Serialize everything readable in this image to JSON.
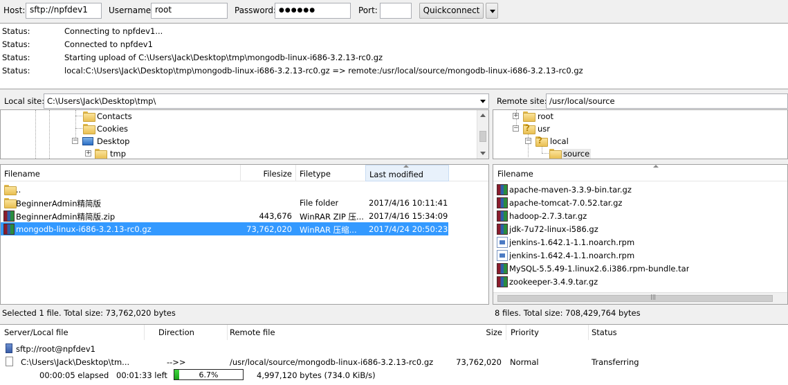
{
  "quickconnect": {
    "host_label": "Host:",
    "host_value": "sftp://npfdev1",
    "username_label": "Username:",
    "username_value": "root",
    "password_label": "Password:",
    "password_value": "●●●●●●",
    "port_label": "Port:",
    "port_value": "",
    "button_label": "Quickconnect"
  },
  "log": [
    {
      "key": "Status:",
      "value": "Connecting to npfdev1..."
    },
    {
      "key": "Status:",
      "value": "Connected to npfdev1"
    },
    {
      "key": "Status:",
      "value": "Starting upload of C:\\Users\\Jack\\Desktop\\tmp\\mongodb-linux-i686-3.2.13-rc0.gz"
    },
    {
      "key": "Status:",
      "value": "local:C:\\Users\\Jack\\Desktop\\tmp\\mongodb-linux-i686-3.2.13-rc0.gz => remote:/usr/local/source/mongodb-linux-i686-3.2.13-rc0.gz"
    }
  ],
  "local": {
    "site_label": "Local site:",
    "site_path": "C:\\Users\\Jack\\Desktop\\tmp\\",
    "tree": [
      "Contacts",
      "Cookies",
      "Desktop",
      "tmp"
    ],
    "columns": [
      "Filename",
      "Filesize",
      "Filetype",
      "Last modified"
    ],
    "files": [
      {
        "name": "..",
        "size": "",
        "type": "",
        "modified": "",
        "icon": "folder-icon"
      },
      {
        "name": "BeginnerAdmin精简版",
        "size": "",
        "type": "File folder",
        "modified": "2017/4/16 10:11:41",
        "icon": "folder-icon"
      },
      {
        "name": "BeginnerAdmin精简版.zip",
        "size": "443,676",
        "type": "WinRAR ZIP 压...",
        "modified": "2017/4/16 15:34:09",
        "icon": "winrar-icon"
      },
      {
        "name": "mongodb-linux-i686-3.2.13-rc0.gz",
        "size": "73,762,020",
        "type": "WinRAR 压缩...",
        "modified": "2017/4/24 20:50:23",
        "icon": "winrar-icon"
      }
    ],
    "status": "Selected 1 file. Total size: 73,762,020 bytes"
  },
  "remote": {
    "site_label": "Remote site:",
    "site_path": "/usr/local/source",
    "tree": [
      "root",
      "usr",
      "local",
      "source"
    ],
    "columns": [
      "Filename"
    ],
    "files": [
      {
        "name": "apache-maven-3.3.9-bin.tar.gz",
        "icon": "winrar-icon"
      },
      {
        "name": "apache-tomcat-7.0.52.tar.gz",
        "icon": "winrar-icon"
      },
      {
        "name": "hadoop-2.7.3.tar.gz",
        "icon": "winrar-icon"
      },
      {
        "name": "jdk-7u72-linux-i586.gz",
        "icon": "winrar-icon"
      },
      {
        "name": "jenkins-1.642.1-1.1.noarch.rpm",
        "icon": "rpm-icon"
      },
      {
        "name": "jenkins-1.642.4-1.1.noarch.rpm",
        "icon": "rpm-icon"
      },
      {
        "name": "MySQL-5.5.49-1.linux2.6.i386.rpm-bundle.tar",
        "icon": "winrar-icon"
      },
      {
        "name": "zookeeper-3.4.9.tar.gz",
        "icon": "winrar-icon"
      }
    ],
    "status": "8 files. Total size: 708,429,764 bytes"
  },
  "queue": {
    "columns": [
      "Server/Local file",
      "Direction",
      "Remote file",
      "Size",
      "Priority",
      "Status"
    ],
    "server": "sftp://root@npfdev1",
    "item": {
      "local_file": "C:\\Users\\Jack\\Desktop\\tm...",
      "direction": "-->>",
      "remote_file": "/usr/local/source/mongodb-linux-i686-3.2.13-rc0.gz",
      "size": "73,762,020",
      "priority": "Normal",
      "status": "Transferring"
    },
    "elapsed": "00:00:05 elapsed",
    "left": "00:01:33 left",
    "progress_fraction": 0.067,
    "progress_text": "6.7%",
    "bytes": "4,997,120 bytes (734.0 KiB/s)"
  }
}
